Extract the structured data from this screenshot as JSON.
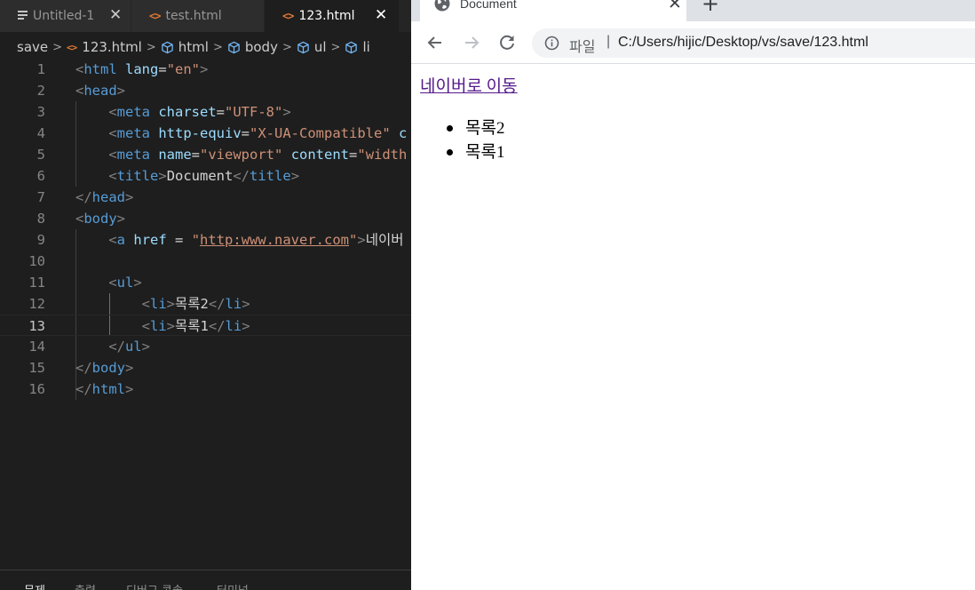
{
  "editor": {
    "tabs": [
      {
        "label": "Untitled-1",
        "icon": "file-lines-icon"
      },
      {
        "label": "test.html",
        "icon": "html-file-icon"
      },
      {
        "label": "123.html",
        "icon": "html-file-icon",
        "active": true
      }
    ],
    "tab_close_glyph": "✕",
    "html_icon_glyph": "<>",
    "breadcrumb": [
      "save",
      "123.html",
      "html",
      "body",
      "ul",
      "li"
    ],
    "breadcrumb_sep": ">",
    "lines": [
      {
        "n": "1",
        "tokens": [
          [
            "tg",
            "<"
          ],
          [
            "tn",
            "html"
          ],
          [
            "tx",
            " "
          ],
          [
            "an",
            "lang"
          ],
          [
            "tx",
            "="
          ],
          [
            "av",
            "\"en\""
          ],
          [
            "tg",
            ">"
          ]
        ]
      },
      {
        "n": "2",
        "tokens": [
          [
            "tg",
            "<"
          ],
          [
            "tn",
            "head"
          ],
          [
            "tg",
            ">"
          ]
        ]
      },
      {
        "n": "3",
        "tokens": [
          [
            "tx",
            "    "
          ],
          [
            "tg",
            "<"
          ],
          [
            "tn",
            "meta"
          ],
          [
            "tx",
            " "
          ],
          [
            "an",
            "charset"
          ],
          [
            "tx",
            "="
          ],
          [
            "av",
            "\"UTF-8\""
          ],
          [
            "tg",
            ">"
          ]
        ]
      },
      {
        "n": "4",
        "tokens": [
          [
            "tx",
            "    "
          ],
          [
            "tg",
            "<"
          ],
          [
            "tn",
            "meta"
          ],
          [
            "tx",
            " "
          ],
          [
            "an",
            "http-equiv"
          ],
          [
            "tx",
            "="
          ],
          [
            "av",
            "\"X-UA-Compatible\""
          ],
          [
            "tx",
            " "
          ],
          [
            "an",
            "c"
          ]
        ]
      },
      {
        "n": "5",
        "tokens": [
          [
            "tx",
            "    "
          ],
          [
            "tg",
            "<"
          ],
          [
            "tn",
            "meta"
          ],
          [
            "tx",
            " "
          ],
          [
            "an",
            "name"
          ],
          [
            "tx",
            "="
          ],
          [
            "av",
            "\"viewport\""
          ],
          [
            "tx",
            " "
          ],
          [
            "an",
            "content"
          ],
          [
            "tx",
            "="
          ],
          [
            "av",
            "\"width"
          ]
        ]
      },
      {
        "n": "6",
        "tokens": [
          [
            "tx",
            "    "
          ],
          [
            "tg",
            "<"
          ],
          [
            "tn",
            "title"
          ],
          [
            "tg",
            ">"
          ],
          [
            "tx",
            "Document"
          ],
          [
            "tg",
            "</"
          ],
          [
            "tn",
            "title"
          ],
          [
            "tg",
            ">"
          ]
        ]
      },
      {
        "n": "7",
        "tokens": [
          [
            "tg",
            "</"
          ],
          [
            "tn",
            "head"
          ],
          [
            "tg",
            ">"
          ]
        ]
      },
      {
        "n": "8",
        "tokens": [
          [
            "tg",
            "<"
          ],
          [
            "tn",
            "body"
          ],
          [
            "tg",
            ">"
          ]
        ]
      },
      {
        "n": "9",
        "tokens": [
          [
            "tx",
            "    "
          ],
          [
            "tg",
            "<"
          ],
          [
            "tn",
            "a"
          ],
          [
            "tx",
            " "
          ],
          [
            "an",
            "href"
          ],
          [
            "tx",
            " = "
          ],
          [
            "av",
            "\""
          ],
          [
            "av link",
            "http:www.naver.com"
          ],
          [
            "av",
            "\""
          ],
          [
            "tg",
            ">"
          ],
          [
            "tx",
            "네이버"
          ]
        ]
      },
      {
        "n": "10",
        "tokens": []
      },
      {
        "n": "11",
        "tokens": [
          [
            "tx",
            "    "
          ],
          [
            "tg",
            "<"
          ],
          [
            "tn",
            "ul"
          ],
          [
            "tg",
            ">"
          ]
        ]
      },
      {
        "n": "12",
        "tokens": [
          [
            "tx",
            "        "
          ],
          [
            "tg",
            "<"
          ],
          [
            "tn",
            "li"
          ],
          [
            "tg",
            ">"
          ],
          [
            "tx",
            "목록2"
          ],
          [
            "tg",
            "</"
          ],
          [
            "tn",
            "li"
          ],
          [
            "tg",
            ">"
          ]
        ]
      },
      {
        "n": "13",
        "tokens": [
          [
            "tx",
            "        "
          ],
          [
            "tg",
            "<"
          ],
          [
            "tn",
            "li"
          ],
          [
            "tg",
            ">"
          ],
          [
            "tx",
            "목록1"
          ],
          [
            "tg",
            "</"
          ],
          [
            "tn",
            "li"
          ],
          [
            "tg",
            ">"
          ]
        ],
        "current": true
      },
      {
        "n": "14",
        "tokens": [
          [
            "tx",
            "    "
          ],
          [
            "tg",
            "</"
          ],
          [
            "tn",
            "ul"
          ],
          [
            "tg",
            ">"
          ]
        ]
      },
      {
        "n": "15",
        "tokens": [
          [
            "tg",
            "</"
          ],
          [
            "tn",
            "body"
          ],
          [
            "tg",
            ">"
          ]
        ]
      },
      {
        "n": "16",
        "tokens": [
          [
            "tg",
            "</"
          ],
          [
            "tn",
            "html"
          ],
          [
            "tg",
            ">"
          ]
        ]
      }
    ],
    "panel_tabs": [
      "문제",
      "출력",
      "디버그 콘솔",
      "터미널"
    ]
  },
  "browser": {
    "tab_title": "Document",
    "tab_close_glyph": "✕",
    "new_tab_glyph": "+",
    "omnibox": {
      "scheme_label": "파일",
      "divider": "|",
      "url": "C:/Users/hijic/Desktop/vs/save/123.html"
    },
    "page": {
      "link_text": "네이버로 이동",
      "list_items": [
        "목록2",
        "목록1"
      ]
    }
  },
  "colors": {
    "editor_bg": "#1e1e1e",
    "tag_name": "#569cd6",
    "attr_name": "#9cdcfe",
    "attr_value": "#ce9178",
    "visited_link": "#551a8b"
  }
}
